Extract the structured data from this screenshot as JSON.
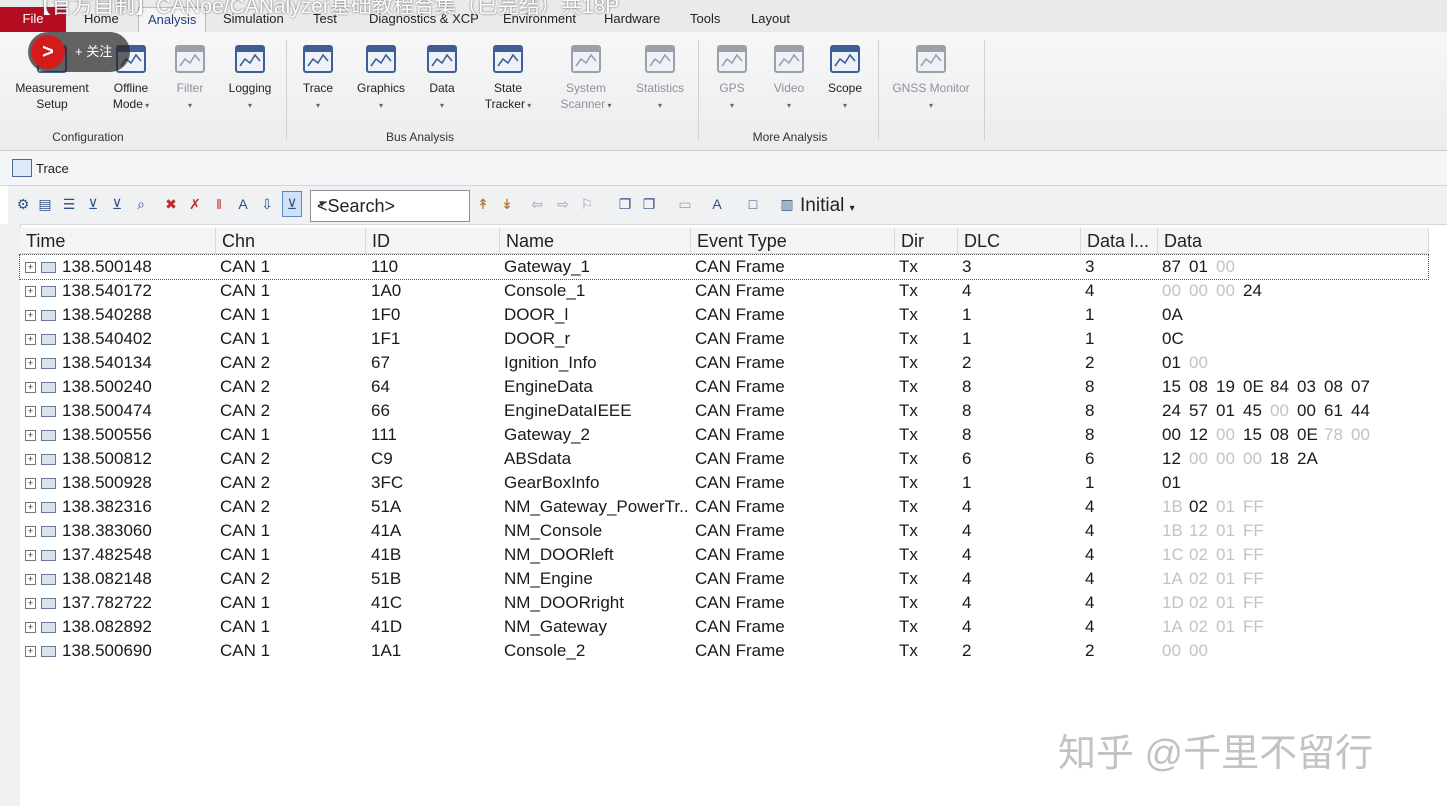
{
  "overlay": {
    "video_title": "【官方自制】CANoe/CANalyzer基础教程合集（已完结）共18P",
    "follow_label": "+ 关注",
    "watermark": "知乎 @千里不留行"
  },
  "menu": {
    "file": "File",
    "items": [
      "Home",
      "Analysis",
      "Simulation",
      "Test",
      "Diagnostics & XCP",
      "Environment",
      "Hardware",
      "Tools",
      "Layout"
    ],
    "active": "Analysis"
  },
  "ribbon": {
    "groups": [
      {
        "label": "Configuration",
        "buttons": [
          {
            "line1": "Measurement",
            "line2": "Setup",
            "arrow": "",
            "icon": "measurement-setup-icon",
            "enabled": true
          },
          {
            "line1": "Offline",
            "line2": "Mode",
            "arrow": "▾",
            "icon": "offline-mode-icon",
            "enabled": true
          },
          {
            "line1": "Filter",
            "line2": "",
            "arrow": "▾",
            "icon": "filter-icon",
            "enabled": false
          },
          {
            "line1": "Logging",
            "line2": "",
            "arrow": "▾",
            "icon": "logging-icon",
            "enabled": true
          }
        ]
      },
      {
        "label": "Bus Analysis",
        "buttons": [
          {
            "line1": "Trace",
            "line2": "",
            "arrow": "▾",
            "icon": "trace-icon",
            "enabled": true
          },
          {
            "line1": "Graphics",
            "line2": "",
            "arrow": "▾",
            "icon": "graphics-icon",
            "enabled": true
          },
          {
            "line1": "Data",
            "line2": "",
            "arrow": "▾",
            "icon": "data-icon",
            "enabled": true
          },
          {
            "line1": "State",
            "line2": "Tracker",
            "arrow": "▾",
            "icon": "state-tracker-icon",
            "enabled": true
          },
          {
            "line1": "System",
            "line2": "Scanner",
            "arrow": "▾",
            "icon": "system-scanner-icon",
            "enabled": false
          },
          {
            "line1": "Statistics",
            "line2": "",
            "arrow": "▾",
            "icon": "statistics-icon",
            "enabled": false
          }
        ]
      },
      {
        "label": "More Analysis",
        "buttons": [
          {
            "line1": "GPS",
            "line2": "",
            "arrow": "▾",
            "icon": "gps-icon",
            "enabled": false
          },
          {
            "line1": "Video",
            "line2": "",
            "arrow": "▾",
            "icon": "video-icon",
            "enabled": false
          },
          {
            "line1": "Scope",
            "line2": "",
            "arrow": "▾",
            "icon": "scope-icon",
            "enabled": true
          }
        ]
      },
      {
        "label": "",
        "buttons": [
          {
            "line1": "GNSS Monitor",
            "line2": "",
            "arrow": "▾",
            "icon": "gnss-monitor-icon",
            "enabled": false
          }
        ]
      }
    ]
  },
  "trace_window": {
    "title": "Trace",
    "search_placeholder": "<Search>",
    "initial_label": "Initial",
    "columns": [
      "Time",
      "Chn",
      "ID",
      "Name",
      "Event Type",
      "Dir",
      "DLC",
      "Data l...",
      "Data"
    ],
    "rows": [
      {
        "time": "138.500148",
        "chn": "CAN 1",
        "id": "110",
        "name": "Gateway_1",
        "event": "CAN Frame",
        "dir": "Tx",
        "dlc": "3",
        "len": "3",
        "data": [
          [
            "87",
            0
          ],
          [
            "01",
            0
          ],
          [
            "00",
            1
          ]
        ]
      },
      {
        "time": "138.540172",
        "chn": "CAN 1",
        "id": "1A0",
        "name": "Console_1",
        "event": "CAN Frame",
        "dir": "Tx",
        "dlc": "4",
        "len": "4",
        "data": [
          [
            "00",
            1
          ],
          [
            "00",
            1
          ],
          [
            "00",
            1
          ],
          [
            "24",
            0
          ]
        ]
      },
      {
        "time": "138.540288",
        "chn": "CAN 1",
        "id": "1F0",
        "name": "DOOR_l",
        "event": "CAN Frame",
        "dir": "Tx",
        "dlc": "1",
        "len": "1",
        "data": [
          [
            "0A",
            0
          ]
        ]
      },
      {
        "time": "138.540402",
        "chn": "CAN 1",
        "id": "1F1",
        "name": "DOOR_r",
        "event": "CAN Frame",
        "dir": "Tx",
        "dlc": "1",
        "len": "1",
        "data": [
          [
            "0C",
            0
          ]
        ]
      },
      {
        "time": "138.540134",
        "chn": "CAN 2",
        "id": "67",
        "name": "Ignition_Info",
        "event": "CAN Frame",
        "dir": "Tx",
        "dlc": "2",
        "len": "2",
        "data": [
          [
            "01",
            0
          ],
          [
            "00",
            1
          ]
        ]
      },
      {
        "time": "138.500240",
        "chn": "CAN 2",
        "id": "64",
        "name": "EngineData",
        "event": "CAN Frame",
        "dir": "Tx",
        "dlc": "8",
        "len": "8",
        "data": [
          [
            "15",
            0
          ],
          [
            "08",
            0
          ],
          [
            "19",
            0
          ],
          [
            "0E",
            0
          ],
          [
            "84",
            0
          ],
          [
            "03",
            0
          ],
          [
            "08",
            0
          ],
          [
            "07",
            0
          ]
        ]
      },
      {
        "time": "138.500474",
        "chn": "CAN 2",
        "id": "66",
        "name": "EngineDataIEEE",
        "event": "CAN Frame",
        "dir": "Tx",
        "dlc": "8",
        "len": "8",
        "data": [
          [
            "24",
            0
          ],
          [
            "57",
            0
          ],
          [
            "01",
            0
          ],
          [
            "45",
            0
          ],
          [
            "00",
            1
          ],
          [
            "00",
            0
          ],
          [
            "61",
            0
          ],
          [
            "44",
            0
          ]
        ]
      },
      {
        "time": "138.500556",
        "chn": "CAN 1",
        "id": "111",
        "name": "Gateway_2",
        "event": "CAN Frame",
        "dir": "Tx",
        "dlc": "8",
        "len": "8",
        "data": [
          [
            "00",
            0
          ],
          [
            "12",
            0
          ],
          [
            "00",
            1
          ],
          [
            "15",
            0
          ],
          [
            "08",
            0
          ],
          [
            "0E",
            0
          ],
          [
            "78",
            1
          ],
          [
            "00",
            1
          ]
        ]
      },
      {
        "time": "138.500812",
        "chn": "CAN 2",
        "id": "C9",
        "name": "ABSdata",
        "event": "CAN Frame",
        "dir": "Tx",
        "dlc": "6",
        "len": "6",
        "data": [
          [
            "12",
            0
          ],
          [
            "00",
            1
          ],
          [
            "00",
            1
          ],
          [
            "00",
            1
          ],
          [
            "18",
            0
          ],
          [
            "2A",
            0
          ]
        ]
      },
      {
        "time": "138.500928",
        "chn": "CAN 2",
        "id": "3FC",
        "name": "GearBoxInfo",
        "event": "CAN Frame",
        "dir": "Tx",
        "dlc": "1",
        "len": "1",
        "data": [
          [
            "01",
            0
          ]
        ]
      },
      {
        "time": "138.382316",
        "chn": "CAN 2",
        "id": "51A",
        "name": "NM_Gateway_PowerTr...",
        "event": "CAN Frame",
        "dir": "Tx",
        "dlc": "4",
        "len": "4",
        "data": [
          [
            "1B",
            1
          ],
          [
            "02",
            0
          ],
          [
            "01",
            1
          ],
          [
            "FF",
            1
          ]
        ]
      },
      {
        "time": "138.383060",
        "chn": "CAN 1",
        "id": "41A",
        "name": "NM_Console",
        "event": "CAN Frame",
        "dir": "Tx",
        "dlc": "4",
        "len": "4",
        "data": [
          [
            "1B",
            1
          ],
          [
            "12",
            1
          ],
          [
            "01",
            1
          ],
          [
            "FF",
            1
          ]
        ]
      },
      {
        "time": "137.482548",
        "chn": "CAN 1",
        "id": "41B",
        "name": "NM_DOORleft",
        "event": "CAN Frame",
        "dir": "Tx",
        "dlc": "4",
        "len": "4",
        "data": [
          [
            "1C",
            1
          ],
          [
            "02",
            1
          ],
          [
            "01",
            1
          ],
          [
            "FF",
            1
          ]
        ]
      },
      {
        "time": "138.082148",
        "chn": "CAN 2",
        "id": "51B",
        "name": "NM_Engine",
        "event": "CAN Frame",
        "dir": "Tx",
        "dlc": "4",
        "len": "4",
        "data": [
          [
            "1A",
            1
          ],
          [
            "02",
            1
          ],
          [
            "01",
            1
          ],
          [
            "FF",
            1
          ]
        ]
      },
      {
        "time": "137.782722",
        "chn": "CAN 1",
        "id": "41C",
        "name": "NM_DOORright",
        "event": "CAN Frame",
        "dir": "Tx",
        "dlc": "4",
        "len": "4",
        "data": [
          [
            "1D",
            1
          ],
          [
            "02",
            1
          ],
          [
            "01",
            1
          ],
          [
            "FF",
            1
          ]
        ]
      },
      {
        "time": "138.082892",
        "chn": "CAN 1",
        "id": "41D",
        "name": "NM_Gateway",
        "event": "CAN Frame",
        "dir": "Tx",
        "dlc": "4",
        "len": "4",
        "data": [
          [
            "1A",
            1
          ],
          [
            "02",
            1
          ],
          [
            "01",
            1
          ],
          [
            "FF",
            1
          ]
        ]
      },
      {
        "time": "138.500690",
        "chn": "CAN 1",
        "id": "1A1",
        "name": "Console_2",
        "event": "CAN Frame",
        "dir": "Tx",
        "dlc": "2",
        "len": "2",
        "data": [
          [
            "00",
            1
          ],
          [
            "00",
            1
          ]
        ]
      }
    ]
  }
}
